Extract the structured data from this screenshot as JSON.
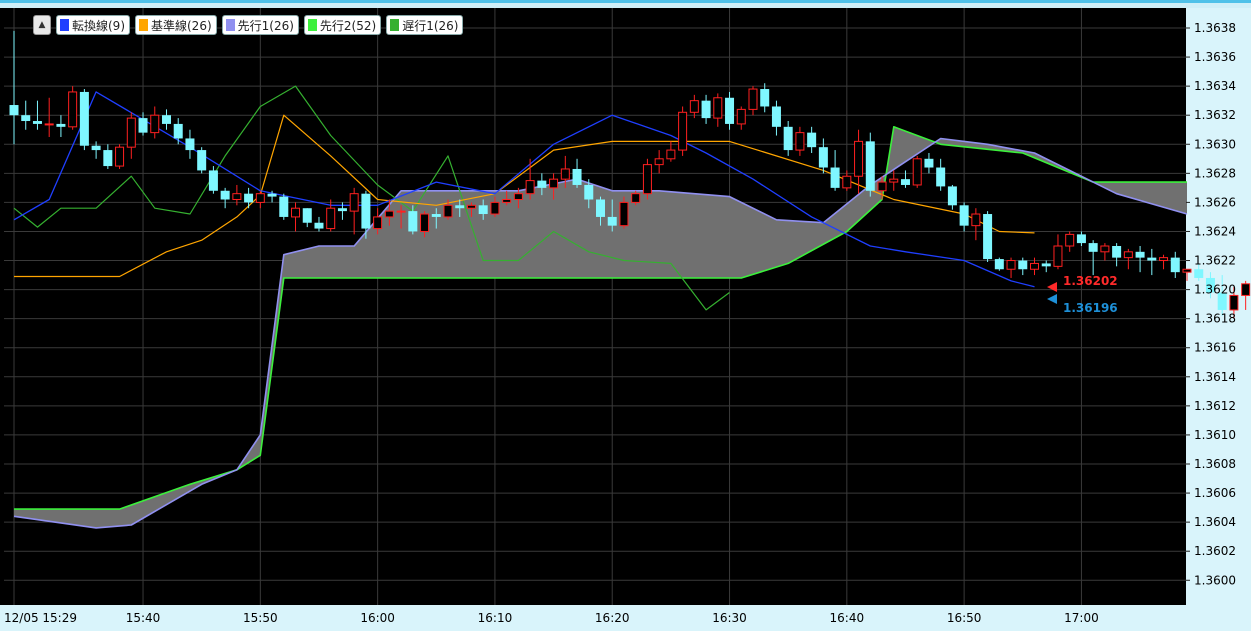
{
  "legend": {
    "collapse_icon": "▲",
    "items": [
      {
        "label": "転換線(9)",
        "color": "#1f3fff"
      },
      {
        "label": "基準線(26)",
        "color": "#ffa500"
      },
      {
        "label": "先行1(26)",
        "color": "#9090f0"
      },
      {
        "label": "先行2(52)",
        "color": "#3cf03c"
      },
      {
        "label": "遅行1(26)",
        "color": "#35b030"
      }
    ]
  },
  "price_labels": {
    "high": "1.36202",
    "low": "1.36196",
    "high_color": "#ff2a2a",
    "low_color": "#1e90d8"
  },
  "chart_data": {
    "type": "candlestick",
    "interval_minutes": 1,
    "y_ticks": [
      "1.3638",
      "1.3636",
      "1.3634",
      "1.3632",
      "1.3630",
      "1.3628",
      "1.3626",
      "1.3624",
      "1.3622",
      "1.3620",
      "1.3618",
      "1.3616",
      "1.3614",
      "1.3612",
      "1.3610",
      "1.3608",
      "1.3606",
      "1.3604",
      "1.3602",
      "1.3600"
    ],
    "ylim": [
      1.35995,
      1.3639
    ],
    "x_ticks": [
      "12/05 15:29",
      "15:40",
      "15:50",
      "16:00",
      "16:10",
      "16:20",
      "16:30",
      "16:40",
      "16:50",
      "17:00"
    ],
    "candles": {
      "start": "15:29",
      "ohlc": [
        [
          1.36327,
          1.36378,
          1.363,
          1.3632
        ],
        [
          1.3632,
          1.3633,
          1.3631,
          1.36316
        ],
        [
          1.36316,
          1.3633,
          1.3631,
          1.36314
        ],
        [
          1.36314,
          1.36332,
          1.36305,
          1.36314
        ],
        [
          1.36314,
          1.3632,
          1.36305,
          1.36312
        ],
        [
          1.36312,
          1.3634,
          1.3631,
          1.36336
        ],
        [
          1.36336,
          1.36338,
          1.36296,
          1.36299
        ],
        [
          1.36299,
          1.36302,
          1.3629,
          1.36296
        ],
        [
          1.36296,
          1.363,
          1.36283,
          1.36285
        ],
        [
          1.36285,
          1.363,
          1.36283,
          1.36298
        ],
        [
          1.36298,
          1.36322,
          1.3629,
          1.36318
        ],
        [
          1.36318,
          1.36322,
          1.36306,
          1.36308
        ],
        [
          1.36308,
          1.36326,
          1.36304,
          1.3632
        ],
        [
          1.3632,
          1.36324,
          1.3631,
          1.36314
        ],
        [
          1.36314,
          1.36318,
          1.363,
          1.36304
        ],
        [
          1.36304,
          1.3631,
          1.3629,
          1.36296
        ],
        [
          1.36296,
          1.36298,
          1.3628,
          1.36282
        ],
        [
          1.36282,
          1.36285,
          1.36266,
          1.36268
        ],
        [
          1.36268,
          1.3627,
          1.36256,
          1.36262
        ],
        [
          1.36262,
          1.36272,
          1.36258,
          1.36266
        ],
        [
          1.36266,
          1.3627,
          1.36256,
          1.3626
        ],
        [
          1.3626,
          1.36268,
          1.36256,
          1.36266
        ],
        [
          1.36266,
          1.36268,
          1.3626,
          1.36264
        ],
        [
          1.36264,
          1.36266,
          1.36248,
          1.3625
        ],
        [
          1.3625,
          1.3626,
          1.3624,
          1.36256
        ],
        [
          1.36256,
          1.36256,
          1.36243,
          1.36246
        ],
        [
          1.36246,
          1.3625,
          1.3624,
          1.36242
        ],
        [
          1.36242,
          1.36262,
          1.3624,
          1.36256
        ],
        [
          1.36256,
          1.3626,
          1.36248,
          1.36254
        ],
        [
          1.36254,
          1.3627,
          1.36238,
          1.36266
        ],
        [
          1.36266,
          1.36268,
          1.36235,
          1.36242
        ],
        [
          1.36242,
          1.36256,
          1.36238,
          1.3625
        ],
        [
          1.3625,
          1.36262,
          1.36244,
          1.36254
        ],
        [
          1.36254,
          1.36258,
          1.36242,
          1.36254
        ],
        [
          1.36254,
          1.36258,
          1.36238,
          1.3624
        ],
        [
          1.3624,
          1.36254,
          1.36236,
          1.36252
        ],
        [
          1.36252,
          1.36256,
          1.36242,
          1.3625
        ],
        [
          1.3625,
          1.36262,
          1.36248,
          1.36258
        ],
        [
          1.36258,
          1.36262,
          1.3625,
          1.36256
        ],
        [
          1.36256,
          1.3626,
          1.3625,
          1.36258
        ],
        [
          1.36258,
          1.36262,
          1.36248,
          1.36252
        ],
        [
          1.36252,
          1.36264,
          1.3625,
          1.3626
        ],
        [
          1.3626,
          1.36268,
          1.36258,
          1.36262
        ],
        [
          1.36262,
          1.3627,
          1.36256,
          1.36266
        ],
        [
          1.36266,
          1.3629,
          1.36262,
          1.36275
        ],
        [
          1.36275,
          1.3628,
          1.36265,
          1.3627
        ],
        [
          1.3627,
          1.3628,
          1.36262,
          1.36276
        ],
        [
          1.36276,
          1.36292,
          1.3627,
          1.36283
        ],
        [
          1.36283,
          1.3629,
          1.3627,
          1.36272
        ],
        [
          1.36272,
          1.36276,
          1.36256,
          1.36262
        ],
        [
          1.36262,
          1.36264,
          1.36244,
          1.3625
        ],
        [
          1.3625,
          1.36262,
          1.3624,
          1.36244
        ],
        [
          1.36244,
          1.36264,
          1.36242,
          1.3626
        ],
        [
          1.3626,
          1.36268,
          1.36258,
          1.36266
        ],
        [
          1.36266,
          1.3629,
          1.36262,
          1.36286
        ],
        [
          1.36286,
          1.36296,
          1.3628,
          1.3629
        ],
        [
          1.3629,
          1.36302,
          1.36288,
          1.36296
        ],
        [
          1.36296,
          1.36326,
          1.36292,
          1.36322
        ],
        [
          1.36322,
          1.36334,
          1.36318,
          1.3633
        ],
        [
          1.3633,
          1.36334,
          1.36314,
          1.36318
        ],
        [
          1.36318,
          1.36335,
          1.36312,
          1.36332
        ],
        [
          1.36332,
          1.36336,
          1.3631,
          1.36314
        ],
        [
          1.36314,
          1.36326,
          1.3631,
          1.36324
        ],
        [
          1.36324,
          1.3634,
          1.3632,
          1.36338
        ],
        [
          1.36338,
          1.36342,
          1.36322,
          1.36326
        ],
        [
          1.36326,
          1.3633,
          1.36306,
          1.36312
        ],
        [
          1.36312,
          1.36316,
          1.36292,
          1.36296
        ],
        [
          1.36296,
          1.36312,
          1.36292,
          1.36308
        ],
        [
          1.36308,
          1.36312,
          1.36294,
          1.36298
        ],
        [
          1.36298,
          1.36304,
          1.3628,
          1.36284
        ],
        [
          1.36284,
          1.36296,
          1.36268,
          1.3627
        ],
        [
          1.3627,
          1.36282,
          1.36268,
          1.36278
        ],
        [
          1.36278,
          1.3631,
          1.36266,
          1.36302
        ],
        [
          1.36302,
          1.36308,
          1.36264,
          1.36268
        ],
        [
          1.36268,
          1.36278,
          1.36262,
          1.36274
        ],
        [
          1.36274,
          1.36282,
          1.36268,
          1.36276
        ],
        [
          1.36276,
          1.36282,
          1.3627,
          1.36272
        ],
        [
          1.36272,
          1.36292,
          1.3627,
          1.3629
        ],
        [
          1.3629,
          1.36294,
          1.3628,
          1.36284
        ],
        [
          1.36284,
          1.3629,
          1.36268,
          1.36271
        ],
        [
          1.36271,
          1.36272,
          1.36255,
          1.36258
        ],
        [
          1.36258,
          1.3626,
          1.3624,
          1.36244
        ],
        [
          1.36244,
          1.36256,
          1.36234,
          1.36252
        ],
        [
          1.36252,
          1.36254,
          1.36219,
          1.36221
        ],
        [
          1.36221,
          1.36222,
          1.36213,
          1.36214
        ],
        [
          1.36214,
          1.36222,
          1.36208,
          1.3622
        ],
        [
          1.3622,
          1.36222,
          1.3621,
          1.36214
        ],
        [
          1.36214,
          1.36222,
          1.3621,
          1.36218
        ],
        [
          1.36218,
          1.3622,
          1.36212,
          1.36216
        ],
        [
          1.36216,
          1.36238,
          1.36214,
          1.3623
        ],
        [
          1.3623,
          1.3624,
          1.36226,
          1.36238
        ],
        [
          1.36238,
          1.3624,
          1.3623,
          1.36232
        ],
        [
          1.36232,
          1.36234,
          1.3621,
          1.36226
        ],
        [
          1.36226,
          1.36232,
          1.3622,
          1.3623
        ],
        [
          1.3623,
          1.36232,
          1.36216,
          1.36222
        ],
        [
          1.36222,
          1.36228,
          1.36214,
          1.36226
        ],
        [
          1.36226,
          1.3623,
          1.36212,
          1.36222
        ],
        [
          1.36222,
          1.36228,
          1.3621,
          1.3622
        ],
        [
          1.3622,
          1.36224,
          1.36214,
          1.36222
        ],
        [
          1.36222,
          1.36226,
          1.36208,
          1.36212
        ],
        [
          1.36212,
          1.36214,
          1.36206,
          1.36214
        ],
        [
          1.36214,
          1.36218,
          1.36206,
          1.36208
        ],
        [
          1.36208,
          1.36212,
          1.36194,
          1.36198
        ],
        [
          1.36198,
          1.3621,
          1.36182,
          1.36186
        ],
        [
          1.36186,
          1.36202,
          1.3618,
          1.36196
        ],
        [
          1.36196,
          1.36206,
          1.36186,
          1.36204
        ],
        [
          1.36204,
          1.36206,
          1.36196,
          1.362
        ],
        [
          1.362,
          1.36202,
          1.36196,
          1.36198
        ],
        [
          1.36198,
          1.36202,
          1.36194,
          1.36196
        ]
      ]
    },
    "tenkan": {
      "x": [
        "15:29",
        "15:32",
        "15:36",
        "15:44",
        "15:50",
        "15:56",
        "16:00",
        "16:05",
        "16:10",
        "16:15",
        "16:20",
        "16:25",
        "16:28",
        "16:32",
        "16:37",
        "16:42",
        "16:45",
        "16:50",
        "16:54",
        "16:56"
      ],
      "y": [
        1.36248,
        1.36262,
        1.36336,
        1.36298,
        1.36268,
        1.36258,
        1.36258,
        1.36274,
        1.36266,
        1.363,
        1.3632,
        1.36306,
        1.36294,
        1.36276,
        1.3625,
        1.3623,
        1.36226,
        1.3622,
        1.36206,
        1.36202
      ]
    },
    "kijun": {
      "x": [
        "15:29",
        "15:38",
        "15:42",
        "15:45",
        "15:48",
        "15:50",
        "15:52",
        "15:56",
        "16:00",
        "16:05",
        "16:10",
        "16:15",
        "16:20",
        "16:30",
        "16:38",
        "16:44",
        "16:50",
        "16:53",
        "16:56"
      ],
      "y": [
        1.36209,
        1.36209,
        1.36226,
        1.36234,
        1.3625,
        1.36265,
        1.3632,
        1.36292,
        1.36262,
        1.36258,
        1.36266,
        1.36296,
        1.36302,
        1.36302,
        1.36282,
        1.36262,
        1.36252,
        1.3624,
        1.36239
      ]
    },
    "chikou": {
      "x": [
        "15:29",
        "15:31",
        "15:33",
        "15:36",
        "15:39",
        "15:41",
        "15:44",
        "15:47",
        "15:50",
        "15:53",
        "15:56",
        "16:00",
        "16:03",
        "16:06",
        "16:09",
        "16:12",
        "16:15",
        "16:18",
        "16:21",
        "16:25",
        "16:28",
        "16:30"
      ],
      "y": [
        1.36256,
        1.36243,
        1.36256,
        1.36256,
        1.36278,
        1.36256,
        1.36252,
        1.36292,
        1.36326,
        1.3634,
        1.36306,
        1.36272,
        1.36254,
        1.36292,
        1.3622,
        1.3622,
        1.3624,
        1.36226,
        1.3622,
        1.36218,
        1.36186,
        1.36198
      ]
    },
    "senkou_a": {
      "x": [
        "15:29",
        "15:36",
        "15:39",
        "15:45",
        "15:48",
        "15:50",
        "15:52",
        "15:55",
        "15:58",
        "16:02",
        "16:12",
        "16:17",
        "16:20",
        "16:24",
        "16:30",
        "16:34",
        "16:38",
        "16:42",
        "16:45",
        "16:48",
        "16:52",
        "16:56",
        "17:03",
        "17:09"
      ],
      "y": [
        1.36044,
        1.36036,
        1.36038,
        1.36066,
        1.36076,
        1.361,
        1.36224,
        1.3623,
        1.3623,
        1.36268,
        1.36268,
        1.36276,
        1.36268,
        1.36268,
        1.36264,
        1.36248,
        1.36246,
        1.36272,
        1.36288,
        1.36304,
        1.363,
        1.36294,
        1.36266,
        1.36252
      ]
    },
    "senkou_b": {
      "x": [
        "15:29",
        "15:38",
        "15:44",
        "15:48",
        "15:50",
        "15:52",
        "16:07",
        "16:31",
        "16:35",
        "16:40",
        "16:43",
        "16:44",
        "16:48",
        "16:55",
        "17:01",
        "17:09"
      ],
      "y": [
        1.36049,
        1.36049,
        1.36066,
        1.36076,
        1.36086,
        1.36208,
        1.36208,
        1.36208,
        1.36218,
        1.3624,
        1.36262,
        1.36312,
        1.363,
        1.36294,
        1.36274,
        1.36274
      ]
    }
  }
}
